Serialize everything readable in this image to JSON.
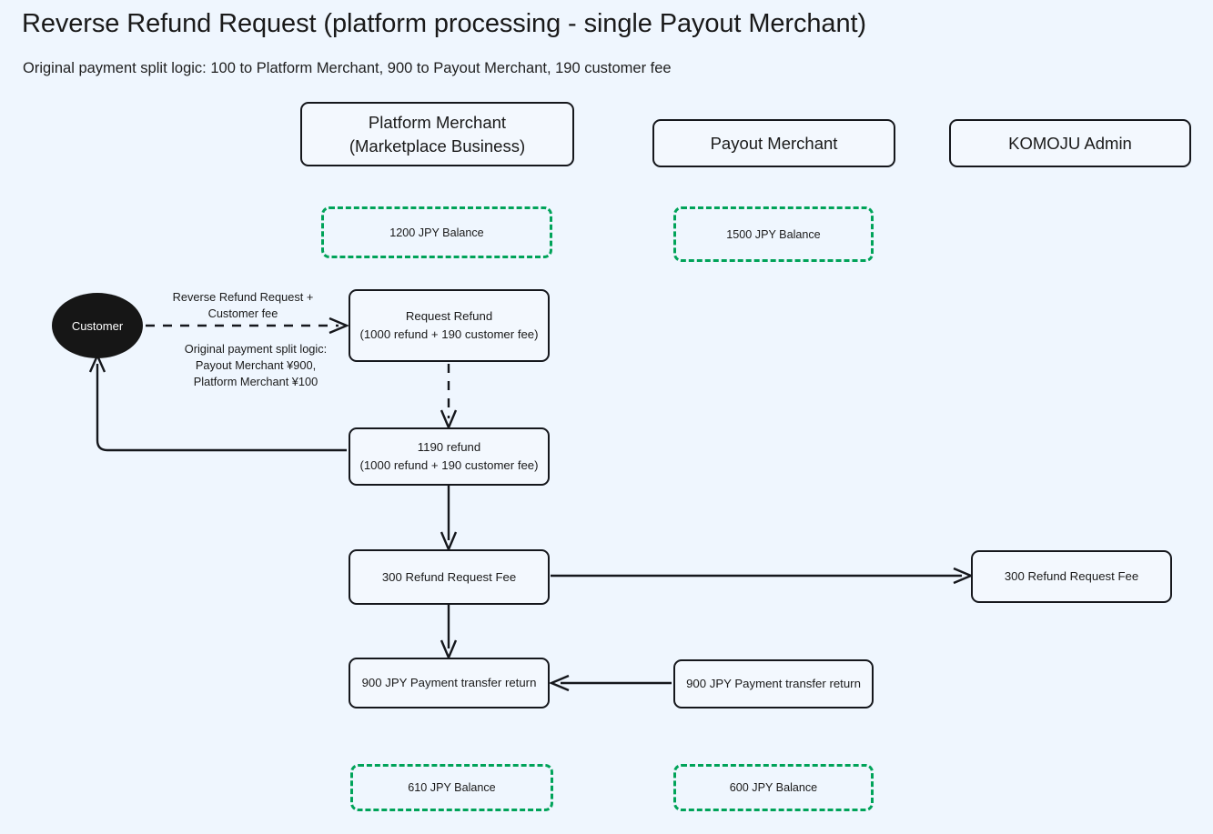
{
  "title": "Reverse Refund Request (platform processing - single Payout Merchant)",
  "subtitle": "Original payment split logic: 100 to Platform Merchant, 900 to Payout Merchant, 190 customer fee",
  "colors": {
    "background": "#eff6fe",
    "node_border": "#15171c",
    "node_fill": "#f3f8fe",
    "balance_border": "#00a359",
    "actor_fill": "#161616",
    "text": "#1a1a1a"
  },
  "lanes": [
    {
      "id": "platform-merchant",
      "line1": "Platform Merchant",
      "line2": "(Marketplace Business)"
    },
    {
      "id": "payout-merchant",
      "line1": "Payout Merchant",
      "line2": ""
    },
    {
      "id": "komoju-admin",
      "line1": "KOMOJU Admin",
      "line2": ""
    }
  ],
  "balances": {
    "platform_start": "1200 JPY Balance",
    "payout_start": "1500 JPY Balance",
    "platform_end": "610 JPY Balance",
    "payout_end": "600 JPY Balance"
  },
  "actor": {
    "label": "Customer"
  },
  "nodes": {
    "request_refund": {
      "line1": "Request Refund",
      "line2": "(1000 refund + 190 customer fee)"
    },
    "refund_1190": {
      "line1": "1190 refund",
      "line2": "(1000 refund + 190 customer fee)"
    },
    "refund_request_fee_platform": {
      "line1": "300 Refund Request Fee"
    },
    "refund_request_fee_admin": {
      "line1": "300 Refund Request Fee"
    },
    "transfer_return_platform": {
      "line1": "900 JPY Payment transfer return"
    },
    "transfer_return_payout": {
      "line1": "900 JPY Payment transfer return"
    }
  },
  "edge_labels": {
    "reverse_request_l1": "Reverse Refund Request +",
    "reverse_request_l2": "Customer fee",
    "split_logic_l1": "Original payment split logic:",
    "split_logic_l2": "Payout Merchant ¥900,",
    "split_logic_l3": "Platform Merchant ¥100"
  }
}
